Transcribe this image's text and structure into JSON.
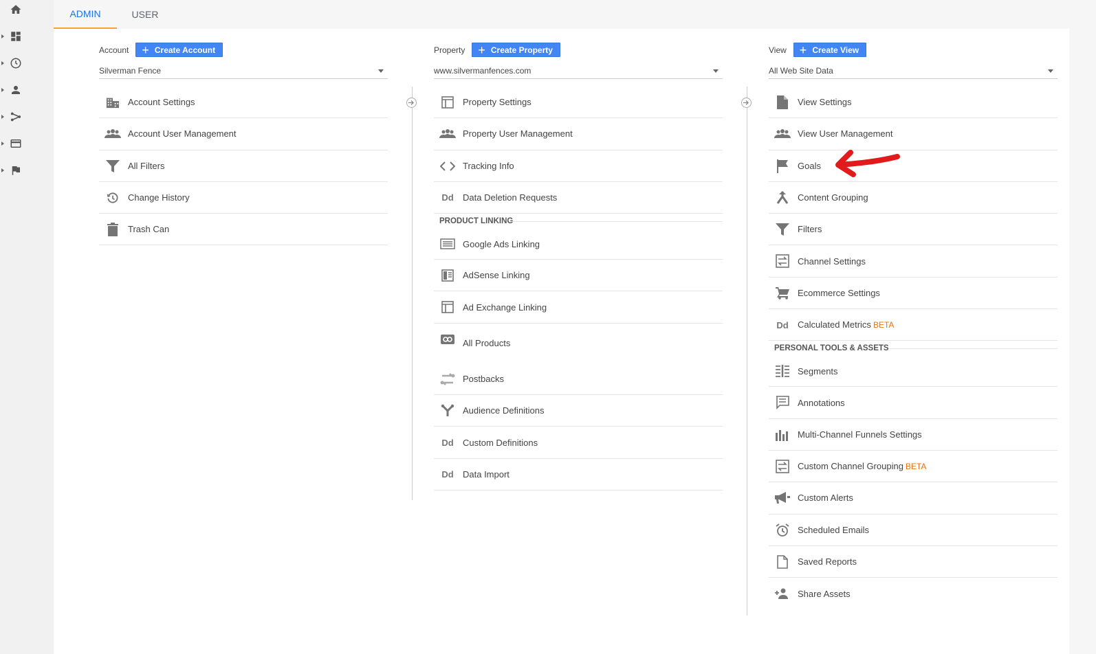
{
  "tabs": {
    "admin": "ADMIN",
    "user": "USER"
  },
  "rail": {
    "items": [
      "home-icon",
      "dashboard-icon",
      "clock-icon",
      "person-icon",
      "acquisition-icon",
      "behavior-icon",
      "flag-icon"
    ]
  },
  "account": {
    "label": "Account",
    "create": "Create Account",
    "selected": "Silverman Fence",
    "items": [
      {
        "icon": "building-icon",
        "label": "Account Settings"
      },
      {
        "icon": "users-icon",
        "label": "Account User Management"
      },
      {
        "icon": "filter-icon",
        "label": "All Filters"
      },
      {
        "icon": "history-icon",
        "label": "Change History"
      },
      {
        "icon": "trash-icon",
        "label": "Trash Can"
      }
    ]
  },
  "property": {
    "label": "Property",
    "create": "Create Property",
    "selected": "www.silvermanfences.com",
    "items": [
      {
        "icon": "layout-icon",
        "label": "Property Settings"
      },
      {
        "icon": "users-icon",
        "label": "Property User Management"
      },
      {
        "icon": "code-icon",
        "label": "Tracking Info"
      },
      {
        "icon": "dd-icon",
        "label": "Data Deletion Requests"
      }
    ],
    "section": "PRODUCT LINKING",
    "linking": [
      {
        "icon": "ads-icon",
        "label": "Google Ads Linking"
      },
      {
        "icon": "adsense-icon",
        "label": "AdSense Linking"
      },
      {
        "icon": "layout-icon",
        "label": "Ad Exchange Linking"
      },
      {
        "icon": "link-icon",
        "label": "All Products"
      }
    ],
    "more": [
      {
        "icon": "postbacks-icon",
        "label": "Postbacks"
      },
      {
        "icon": "audience-icon",
        "label": "Audience Definitions"
      },
      {
        "icon": "dd-icon",
        "label": "Custom Definitions"
      },
      {
        "icon": "dd-icon",
        "label": "Data Import"
      }
    ]
  },
  "view": {
    "label": "View",
    "create": "Create View",
    "selected": "All Web Site Data",
    "items": [
      {
        "icon": "document-icon",
        "label": "View Settings"
      },
      {
        "icon": "users-icon",
        "label": "View User Management"
      },
      {
        "icon": "flag-icon",
        "label": "Goals"
      },
      {
        "icon": "grouping-icon",
        "label": "Content Grouping"
      },
      {
        "icon": "filter-icon",
        "label": "Filters"
      },
      {
        "icon": "channel-icon",
        "label": "Channel Settings"
      },
      {
        "icon": "cart-icon",
        "label": "Ecommerce Settings"
      },
      {
        "icon": "dd-icon",
        "label": "Calculated Metrics",
        "beta": "BETA"
      }
    ],
    "section": "PERSONAL TOOLS & ASSETS",
    "tools": [
      {
        "icon": "segments-icon",
        "label": "Segments"
      },
      {
        "icon": "annotation-icon",
        "label": "Annotations"
      },
      {
        "icon": "bars-icon",
        "label": "Multi-Channel Funnels Settings"
      },
      {
        "icon": "channel-icon",
        "label": "Custom Channel Grouping",
        "beta": "BETA"
      },
      {
        "icon": "megaphone-icon",
        "label": "Custom Alerts"
      },
      {
        "icon": "alarm-icon",
        "label": "Scheduled Emails"
      },
      {
        "icon": "page-icon",
        "label": "Saved Reports"
      },
      {
        "icon": "person-add-icon",
        "label": "Share Assets"
      }
    ]
  },
  "dd_glyph": "Dd",
  "colors": {
    "accent": "#1a73e8",
    "button": "#4285f4",
    "tab_underline": "#f6a035",
    "beta": "#e8710a",
    "annotation": "#e11b1b"
  }
}
